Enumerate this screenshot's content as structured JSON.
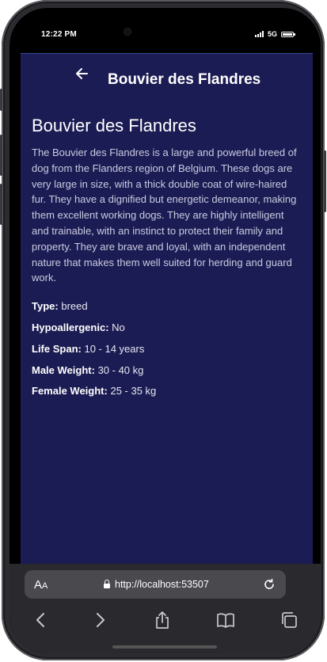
{
  "status_bar": {
    "time": "12:22 PM",
    "network": "5G"
  },
  "app_bar": {
    "back_icon": "arrow-left-icon",
    "title": "Bouvier des Flandres"
  },
  "breed": {
    "name": "Bouvier des Flandres",
    "description": "The Bouvier des Flandres is a large and powerful breed of dog from the Flanders region of Belgium. These dogs are very large in size, with a thick double coat of wire-haired fur. They have a dignified but energetic demeanor, making them excellent working dogs. They are highly intelligent and trainable, with an instinct to protect their family and property. They are brave and loyal, with an independent nature that makes them well suited for herding and guard work.",
    "facts": [
      {
        "label": "Type:",
        "value": "breed"
      },
      {
        "label": "Hypoallergenic:",
        "value": "No"
      },
      {
        "label": "Life Span:",
        "value": "10 - 14 years"
      },
      {
        "label": "Male Weight:",
        "value": "30 - 40 kg"
      },
      {
        "label": "Female Weight:",
        "value": "25 - 35 kg"
      }
    ]
  },
  "browser": {
    "text_size_label_big": "A",
    "text_size_label_small": "A",
    "url": "http://localhost:53507",
    "toolbar_icons": [
      "back-icon",
      "forward-icon",
      "share-icon",
      "bookmarks-icon",
      "tabs-icon"
    ]
  },
  "colors": {
    "app_background": "#1c1c54",
    "browser_chrome": "#2a2a2e",
    "url_bar": "#4a4a4e"
  }
}
